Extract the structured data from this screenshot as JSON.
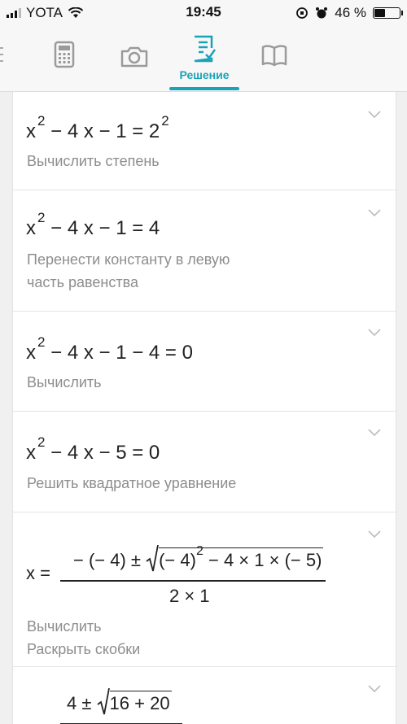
{
  "status_bar": {
    "carrier": "YOTA",
    "time": "19:45",
    "battery_percent": "46 %",
    "battery_level": 0.46
  },
  "nav": {
    "tabs": [
      {
        "icon": "calculator-icon"
      },
      {
        "icon": "camera-icon"
      },
      {
        "icon": "solution-icon",
        "label": "Решение",
        "active": true
      },
      {
        "icon": "book-icon"
      }
    ],
    "accent_color": "#1aa3b8"
  },
  "steps": [
    {
      "eq": {
        "a": "x",
        "a_exp": "2",
        "b": " − 4 x − 1 = 2",
        "b_exp": "2"
      },
      "desc": "Вычислить степень"
    },
    {
      "eq": {
        "a": "x",
        "a_exp": "2",
        "b": " − 4 x − 1 = 4"
      },
      "desc_line1": "Перенести константу в левую",
      "desc_line2": "часть равенства"
    },
    {
      "eq": {
        "a": "x",
        "a_exp": "2",
        "b": " − 4 x − 1 − 4 = 0"
      },
      "desc": "Вычислить"
    },
    {
      "eq": {
        "a": "x",
        "a_exp": "2",
        "b": " − 4 x − 5 = 0"
      },
      "desc": "Решить квадратное уравнение"
    },
    {
      "lhs": "x =",
      "numerator_pre": "− (− 4) ± ",
      "radicand": "(− 4)",
      "radicand_exp": "2",
      "radicand_post": " − 4 × 1 × (− 5)",
      "denominator": "2 × 1",
      "desc_line1": "Вычислить",
      "desc_line2": "Раскрыть скобки"
    },
    {
      "lhs": "x =",
      "numerator_pre": "4 ± ",
      "radicand": "16 + 20"
    }
  ]
}
